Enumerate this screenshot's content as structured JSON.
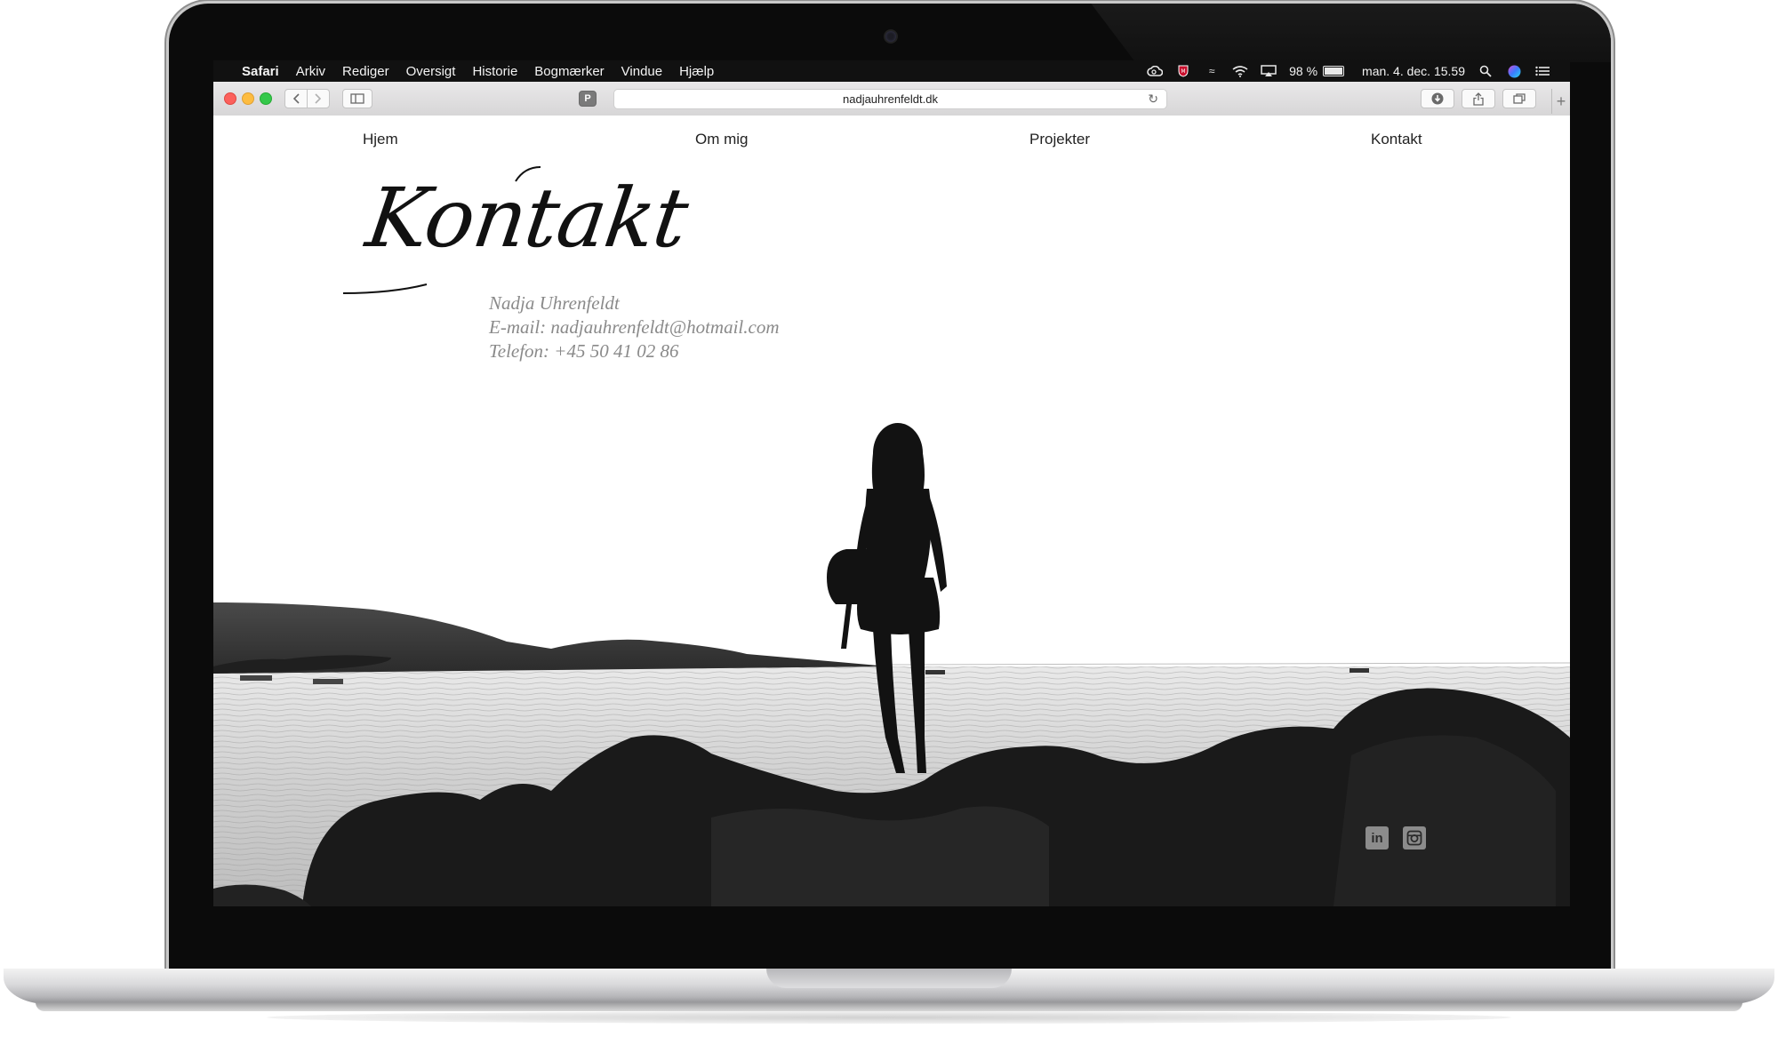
{
  "menubar": {
    "apple_icon": "apple-icon",
    "items": [
      "Safari",
      "Arkiv",
      "Rediger",
      "Oversigt",
      "Historie",
      "Bogmærker",
      "Vindue",
      "Hjælp"
    ],
    "battery": "98 %",
    "clock": "man. 4. dec.  15.59"
  },
  "browser": {
    "url": "nadjauhrenfeldt.dk",
    "new_tab": "+"
  },
  "site": {
    "nav": [
      "Hjem",
      "Om mig",
      "Projekter",
      "Kontakt"
    ],
    "heading": "Kontakt",
    "contact_name": "Nadja Uhrenfeldt",
    "contact_email": "E-mail: nadjauhrenfeldt@hotmail.com",
    "contact_phone": "Telefon: +45 50 41 02 86",
    "social": [
      "linkedin-icon",
      "instagram-icon"
    ],
    "linkedin_glyph": "in"
  }
}
